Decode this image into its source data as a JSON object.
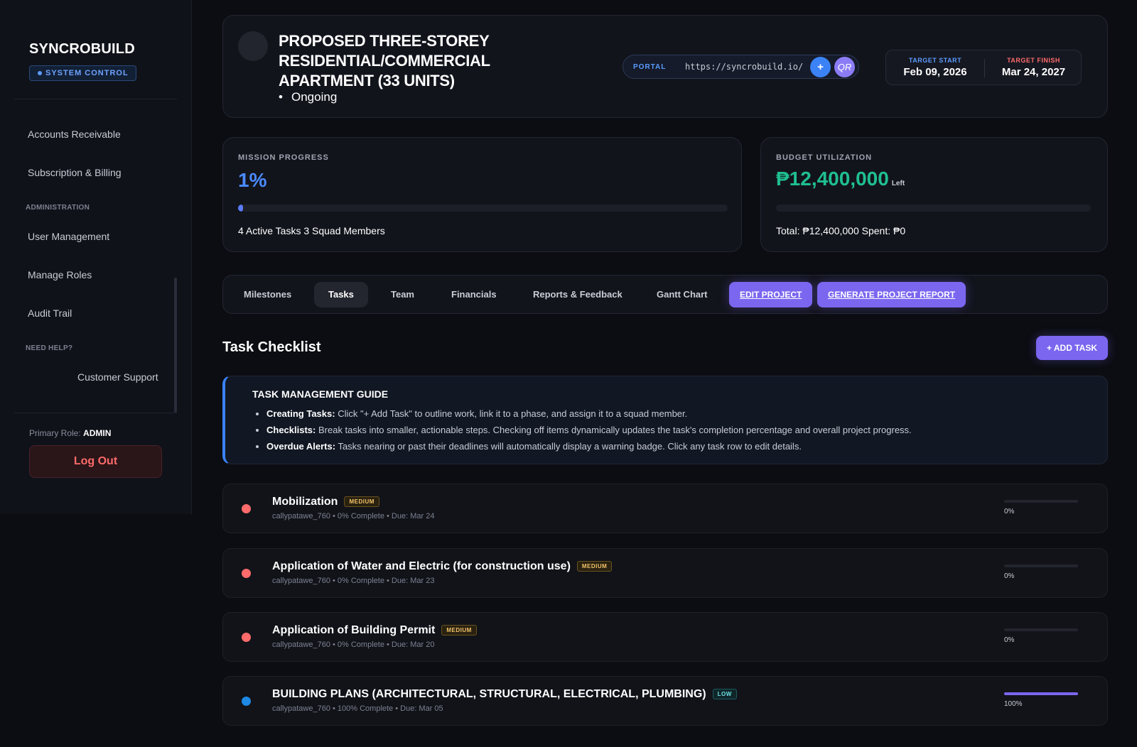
{
  "sidebar": {
    "brand": "SYNCROBUILD",
    "badge": "SYSTEM CONTROL",
    "items": [
      {
        "label": "Accounts Receivable"
      },
      {
        "label": "Subscription & Billing"
      },
      {
        "label": "User Management"
      },
      {
        "label": "Manage Roles"
      },
      {
        "label": "Audit Trail"
      },
      {
        "label": "Customer Support"
      }
    ],
    "sections": {
      "admin": "ADMINISTRATION",
      "help": "NEED HELP?"
    },
    "role_label": "Primary Role:",
    "role_value": "ADMIN",
    "logout": "Log Out"
  },
  "header": {
    "title": "PROPOSED THREE-STOREY RESIDENTIAL/COMMERCIAL APARTMENT (33 UNITS)",
    "status": "Ongoing",
    "portal_label": "PORTAL",
    "portal_url": "https://syncrobuild.io/",
    "plus_label": "+",
    "qr_label": "QR",
    "target_start_label": "TARGET START",
    "target_start": "Feb 09, 2026",
    "target_finish_label": "TARGET FINISH",
    "target_finish": "Mar 24, 2027"
  },
  "mission": {
    "label": "MISSION PROGRESS",
    "value": "1%",
    "progress": 0.01,
    "foot": "4 Active Tasks 3 Squad Members"
  },
  "budget": {
    "label": "BUDGET UTILIZATION",
    "value": "₱12,400,000",
    "suffix": "Left",
    "progress": 0,
    "foot": "Total: ₱12,400,000 Spent: ₱0"
  },
  "tabs": [
    {
      "label": "Milestones"
    },
    {
      "label": "Tasks"
    },
    {
      "label": "Team"
    },
    {
      "label": "Financials"
    },
    {
      "label": "Reports & Feedback"
    },
    {
      "label": "Gantt Chart"
    }
  ],
  "actions": {
    "edit": "EDIT PROJECT",
    "report": "GENERATE PROJECT REPORT"
  },
  "checklist": {
    "title": "Task Checklist",
    "add_task": "+ ADD TASK",
    "guide_title": "TASK MANAGEMENT GUIDE",
    "guide": [
      {
        "bold": "Creating Tasks:",
        "text": " Click \"+ Add Task\" to outline work, link it to a phase, and assign it to a squad member."
      },
      {
        "bold": "Checklists:",
        "text": " Break tasks into smaller, actionable steps. Checking off items dynamically updates the task's completion percentage and overall project progress."
      },
      {
        "bold": "Overdue Alerts:",
        "text": " Tasks nearing or past their deadlines will automatically display a warning badge. Click any task row to edit details."
      }
    ]
  },
  "tasks": [
    {
      "name": "Mobilization",
      "priority": "MEDIUM",
      "meta": "callypatawe_760  •  0% Complete  • Due: Mar 24",
      "pct": "0%",
      "progress": 0,
      "dot": "#ff6b6b"
    },
    {
      "name": "Application of Water and Electric (for construction use)",
      "priority": "MEDIUM",
      "meta": "callypatawe_760  •  0% Complete  • Due: Mar 23",
      "pct": "0%",
      "progress": 0,
      "dot": "#ff6b6b"
    },
    {
      "name": "Application of Building Permit",
      "priority": "MEDIUM",
      "meta": "callypatawe_760  •  0% Complete  • Due: Mar 20",
      "pct": "0%",
      "progress": 0,
      "dot": "#ff6b6b"
    },
    {
      "name": "BUILDING PLANS (ARCHITECTURAL, STRUCTURAL, ELECTRICAL, PLUMBING)",
      "priority": "LOW",
      "meta": "callypatawe_760  •  100% Complete  • Due: Mar 05",
      "pct": "100%",
      "progress": 1,
      "dot": "#1e88e5"
    }
  ]
}
